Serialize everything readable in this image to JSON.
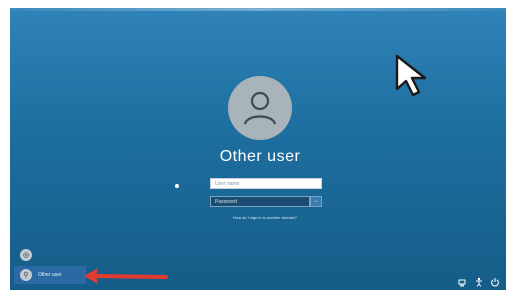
{
  "lock_screen": {
    "selected_user_name": "Other user",
    "username_placeholder": "User name",
    "password_placeholder": "Password",
    "submit_glyph": "→",
    "signin_link_text": "How do I sign in to another domain?"
  },
  "user_list": [
    {
      "name": "",
      "initial": "◎",
      "active": false
    },
    {
      "name": "Other user",
      "initial": "⚲",
      "active": true
    }
  ],
  "icons": {
    "avatar_icon": "person-outline-icon",
    "cursor_icon": "pointer-cursor-icon",
    "network_icon": "network-icon",
    "accessibility_icon": "ease-of-access-icon",
    "power_icon": "power-icon"
  },
  "colors": {
    "background_top": "#2f83b8",
    "background_bottom": "#155d88",
    "avatar": "#a9b3ba",
    "active_user_row": "#2a69a3",
    "annotation_arrow": "#e53a2e"
  }
}
